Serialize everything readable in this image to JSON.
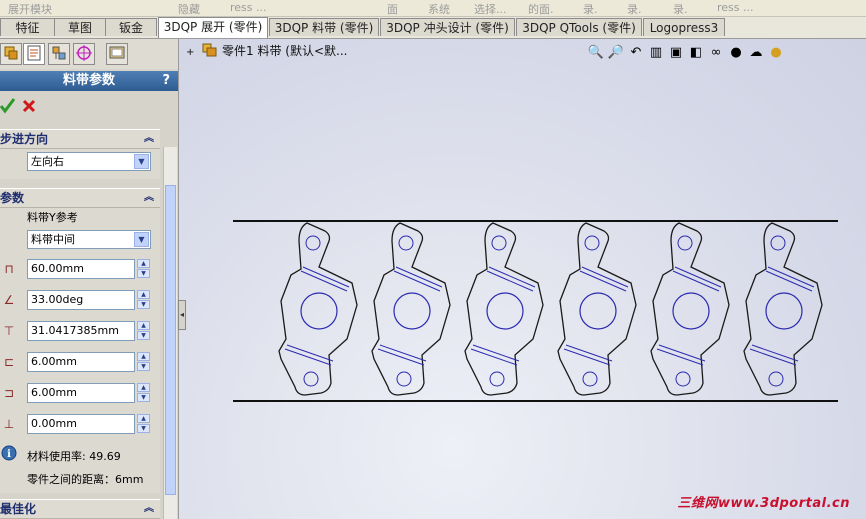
{
  "toolbar": {
    "items": [
      "展开模块",
      "隐藏",
      "ress ...",
      "面",
      "系统",
      "选择...",
      "的面.",
      "录.",
      "录.",
      "录.",
      "ress ..."
    ]
  },
  "tabs": [
    "特征",
    "草图",
    "钣金",
    "3DQP 展开 (零件)",
    "3DQP 料带 (零件)",
    "3DQP 冲头设计 (零件)",
    "3DQP QTools (零件)",
    "Logopress3"
  ],
  "active_tab": "3DQP 展开 (零件)",
  "panel": {
    "title": "料带参数",
    "help": "?",
    "ok_icon": "check-icon",
    "cancel_icon": "cross-icon",
    "section_direction": {
      "title": "步进方向",
      "value": "左向右"
    },
    "section_params": {
      "title": "参数",
      "ref_label": "料带Y参考",
      "ref_value": "料带中间",
      "fields": [
        "60.00mm",
        "33.00deg",
        "31.0417385mm",
        "6.00mm",
        "6.00mm",
        "0.00mm"
      ],
      "usage_label": "材料使用率: 49.69",
      "distance_label": "零件之间的距离：6mm"
    },
    "section_optimize": {
      "title": "最佳化"
    }
  },
  "tree": {
    "expander": "+",
    "text": "零件1 料带   (默认<默..."
  },
  "view_toolbar": {
    "icons": [
      "zoom-to-fit-icon",
      "zoom-area-icon",
      "previous-view-icon",
      "section-view-icon",
      "view-orientation-icon",
      "display-style-icon",
      "hide-show-icon",
      "appearance-icon",
      "scene-icon",
      "render-icon"
    ]
  },
  "strip": {
    "part_count": 6
  },
  "watermark": "三维网www.3dportal.cn",
  "colors": {
    "accent": "#2d5c92",
    "part_stroke": "#1a1a1a",
    "hole_stroke": "#2a2ab0",
    "watermark": "#c8102e"
  }
}
